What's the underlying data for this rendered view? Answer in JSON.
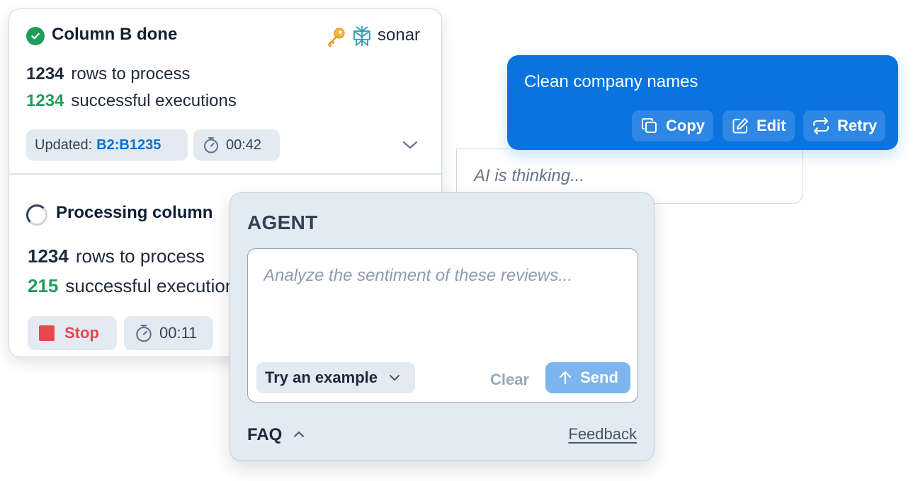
{
  "status_card": {
    "done_section": {
      "title": "Column B done",
      "model_name": "sonar",
      "rows_count": "1234",
      "rows_label": "rows to process",
      "success_count": "1234",
      "success_label": "successful executions",
      "updated_label": "Updated:",
      "updated_range": "B2:B1235",
      "elapsed": "00:42"
    },
    "processing_section": {
      "title": "Processing column",
      "rows_count": "1234",
      "rows_label": "rows to process",
      "success_count": "215",
      "success_label": "successful executions",
      "stop_label": "Stop",
      "elapsed": "00:11"
    }
  },
  "message": {
    "text": "Clean company names",
    "copy_label": "Copy",
    "edit_label": "Edit",
    "retry_label": "Retry"
  },
  "thinking": {
    "text": "AI is thinking..."
  },
  "agent": {
    "title": "AGENT",
    "prompt_value": "",
    "prompt_placeholder": "Analyze the sentiment of these reviews...",
    "try_example_label": "Try an example",
    "clear_label": "Clear",
    "send_label": "Send",
    "faq_label": "FAQ",
    "feedback_label": "Feedback"
  },
  "colors": {
    "primary_blue": "#0a73e0",
    "success_green": "#1f9d5c",
    "danger_red": "#e5484d",
    "link_blue": "#0f6fd1",
    "send_disabled": "#7db6ee"
  },
  "icons": [
    "check-circle-icon",
    "key-icon",
    "perplexity-logo-icon",
    "timer-icon",
    "chevron-down-icon",
    "spinner-icon",
    "stop-icon",
    "copy-icon",
    "edit-icon",
    "retry-icon",
    "arrow-up-icon",
    "chevron-up-icon"
  ]
}
